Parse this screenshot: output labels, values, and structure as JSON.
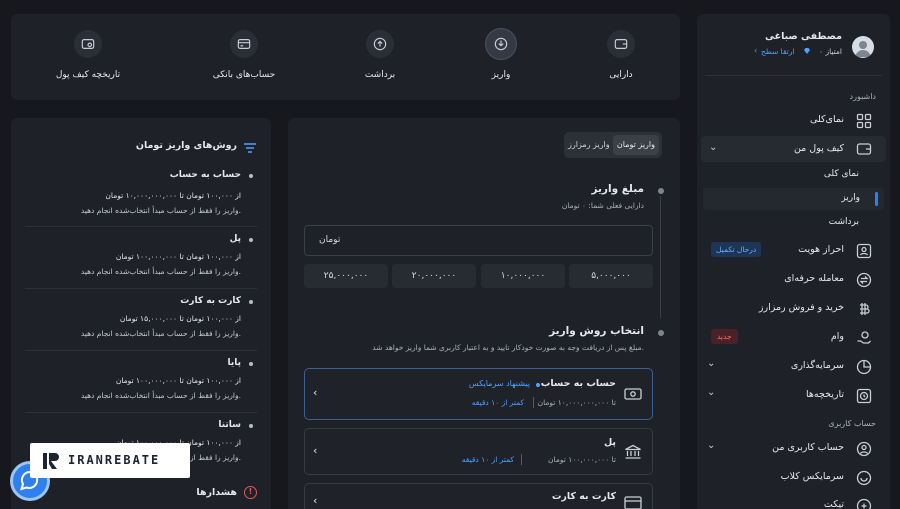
{
  "user": {
    "name": "مصطفی صباغی",
    "points": "۰ امتیاز",
    "upgrade": "ارتقا سطح"
  },
  "sidebar": {
    "dashboard_header": "داشبورد",
    "overview": "نمای‌کلی",
    "my_wallet": "کیف پول من",
    "wallet_sub": {
      "overview": "نمای کلی",
      "deposit": "واریز",
      "withdraw": "برداشت"
    },
    "verification": "احراز هویت",
    "verification_badge": "درحال تکمیل",
    "pro_trade": "معامله حرفه‌ای",
    "crypto": "خرید و فروش رمزارز",
    "loan": "وام",
    "loan_badge": "جدید",
    "investment": "سرمایه‌گذاری",
    "history": "تاریخچه‌ها",
    "account_header": "حساب کاربری",
    "my_account": "حساب کاربری من",
    "club": "سرمایکس کلاب",
    "ticket": "تیکت"
  },
  "topnav": {
    "assets": "دارایی",
    "deposit": "واریز",
    "withdraw": "برداشت",
    "bank_accounts": "حساب‌های بانکی",
    "wallet_history": "تاریخچه کیف پول"
  },
  "deposit": {
    "tabs": {
      "toman": "واریز تومان",
      "crypto": "واریز رمزارز"
    },
    "amount_title": "مبلغ واریز",
    "balance": "دارایی فعلی شما: ۰ تومان",
    "input_placeholder": "تومان",
    "quick": [
      "۵,۰۰۰,۰۰۰",
      "۱۰,۰۰۰,۰۰۰",
      "۲۰,۰۰۰,۰۰۰",
      "۲۵,۰۰۰,۰۰۰"
    ],
    "method_title": "انتخاب روش واریز",
    "method_desc": "مبلغ پس از دریافت وجه به صورت خودکار تایید و به اعتبار کاربری شما واریز خواهد شد.",
    "options": [
      {
        "title": "حساب به حساب",
        "recommend": "پیشنهاد سرمایکس",
        "limit": "تا ۱۰,۰۰۰,۰۰۰,۰۰۰ تومان",
        "time": "کمتر از ۱۰ دقیقه"
      },
      {
        "title": "پل",
        "limit": "تا ۱۰۰,۰۰۰,۰۰۰ تومان",
        "time": "کمتر از ۱۰ دقیقه"
      },
      {
        "title": "کارت به کارت"
      }
    ]
  },
  "methods": {
    "title": "روش‌های واریز تومان",
    "items": [
      {
        "name": "حساب به حساب",
        "range": "از ۱۰۰,۰۰۰ تومان تا ۱۰,۰۰۰,۰۰۰,۰۰۰ تومان",
        "note": "واریز را فقط از حساب مبدأ انتخاب‌شده انجام دهید."
      },
      {
        "name": "پل",
        "range": "از ۱۰۰,۰۰۰ تومان تا ۱۰۰,۰۰۰,۰۰۰ تومان",
        "note": "واریز را فقط از حساب مبدأ انتخاب‌شده انجام دهید."
      },
      {
        "name": "کارت به کارت",
        "range": "از ۱۰۰,۰۰۰ تومان تا ۱۵,۰۰۰,۰۰۰ تومان",
        "note": "واریز را فقط از حساب مبدأ انتخاب‌شده انجام دهید."
      },
      {
        "name": "پایا",
        "range": "از ۱۰۰,۰۰۰ تومان تا ۱۰۰,۰۰۰,۰۰۰ تومان",
        "note": "واریز را فقط از حساب مبدأ انتخاب‌شده انجام دهید."
      },
      {
        "name": "ساتنا",
        "range": "از ۱۰۰,۰۰۰ تومان تا ۱۰۰,۰۰۰,۰۰۰ تومان",
        "note": "واریز را فقط از حساب مبدأ انتخاب‌شده انجام دهید."
      }
    ],
    "warnings": "هشدارها"
  },
  "watermark": "IRANREBATE",
  "colors": {
    "accent": "#2f80ed",
    "bg": "#16181d",
    "panel": "#1e2127",
    "danger": "#e05a5a"
  }
}
